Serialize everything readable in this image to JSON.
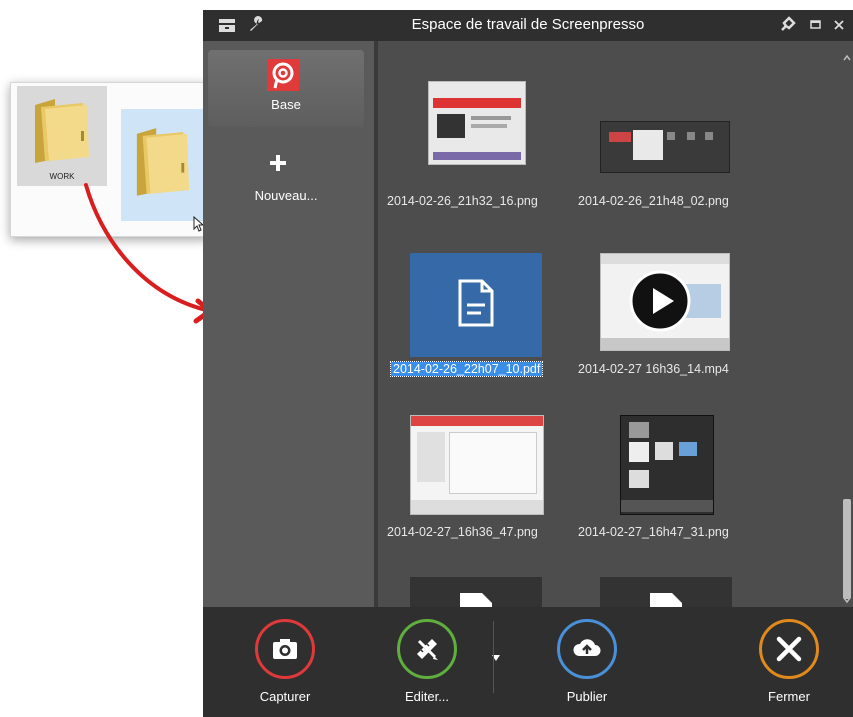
{
  "explorer": {
    "work_folder_label": "WORK"
  },
  "window": {
    "title": "Espace de travail de Screenpresso"
  },
  "sidebar": {
    "workspaces": [
      {
        "label": "Base"
      },
      {
        "label": "Nouveau..."
      }
    ]
  },
  "gallery": {
    "items": [
      {
        "caption": "2014-02-26_21h32_16.png"
      },
      {
        "caption": "2014-02-26_21h48_02.png"
      },
      {
        "caption": "2014-02-26_22h07_10.pdf",
        "selected": true
      },
      {
        "caption": "2014-02-27 16h36_14.mp4"
      },
      {
        "caption": "2014-02-27_16h36_47.png"
      },
      {
        "caption": "2014-02-27_16h47_31.png"
      }
    ]
  },
  "toolbar": {
    "capture": "Capturer",
    "edit": "Editer...",
    "publish": "Publier",
    "close": "Fermer"
  },
  "colors": {
    "capture": "#e0393b",
    "edit": "#5fae3e",
    "publish": "#4a90d9",
    "close": "#e08a1e",
    "selection": "#3a8ee6"
  }
}
